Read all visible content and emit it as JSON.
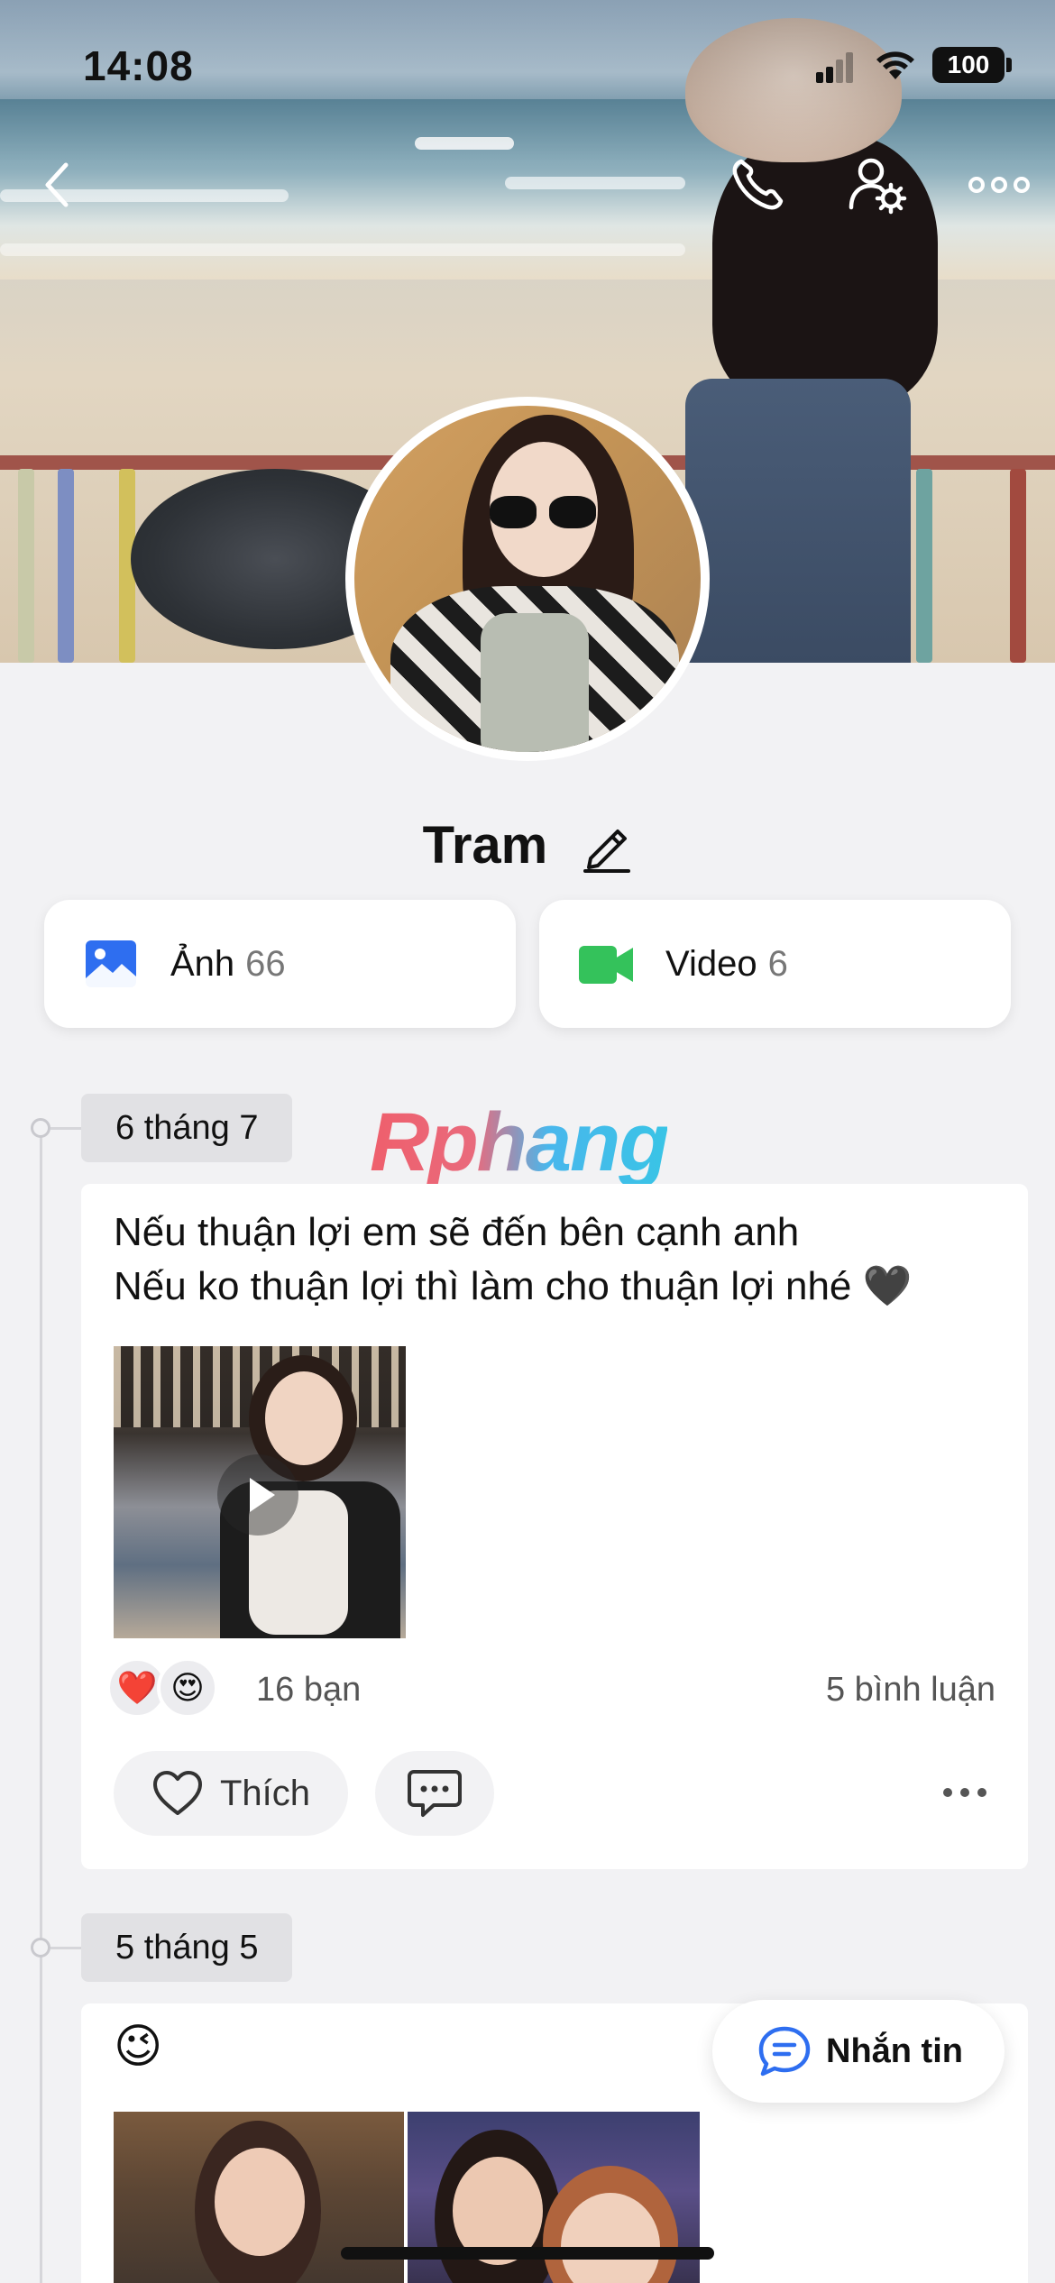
{
  "status_bar": {
    "time": "14:08",
    "battery": "100"
  },
  "profile": {
    "name": "Tram"
  },
  "media": {
    "photos": {
      "label": "Ảnh",
      "count": "66"
    },
    "videos": {
      "label": "Video",
      "count": "6"
    }
  },
  "watermark": "Rphang",
  "posts": [
    {
      "date": "6 tháng 7",
      "text_lines": [
        "Nếu thuận lợi em sẽ đến bên cạnh anh",
        "Nếu ko thuận lợi thì làm cho thuận lợi nhé 🖤"
      ],
      "reactions": [
        "❤️",
        "😍"
      ],
      "reaction_count": "16 bạn",
      "comment_count": "5 bình luận",
      "like_label": "Thích"
    },
    {
      "date": "5 tháng 5",
      "text": "😉"
    }
  ],
  "message_button": {
    "label": "Nhắn tin"
  },
  "colors": {
    "photo_icon": "#2e6ef0",
    "video_icon": "#34c25b",
    "chip_bg": "#e1e1e4"
  }
}
